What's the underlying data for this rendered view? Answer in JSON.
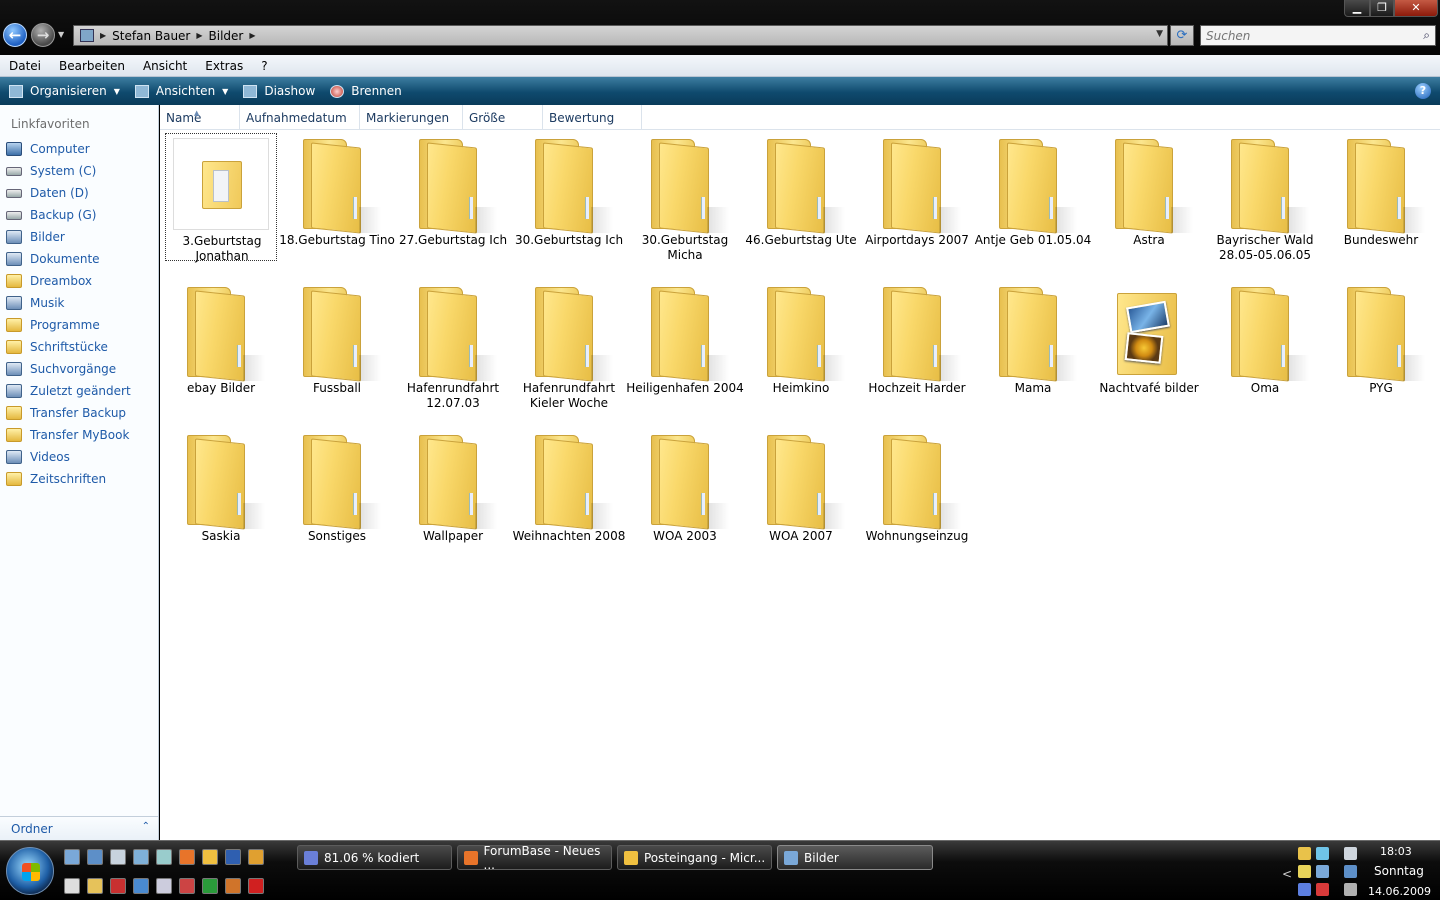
{
  "window": {
    "controls": {
      "minimize": "▁",
      "maximize": "❐",
      "close": "✕"
    }
  },
  "address": {
    "crumbs": [
      "Stefan Bauer",
      "Bilder"
    ],
    "search_placeholder": "Suchen"
  },
  "menu": [
    "Datei",
    "Bearbeiten",
    "Ansicht",
    "Extras",
    "?"
  ],
  "toolbar": {
    "organize": "Organisieren",
    "views": "Ansichten",
    "slideshow": "Diashow",
    "burn": "Brennen",
    "help": "?"
  },
  "nav": {
    "heading": "Linkfavoriten",
    "items": [
      {
        "label": "Computer",
        "icon": "computer-icon"
      },
      {
        "label": "System (C)",
        "icon": "drive-icon"
      },
      {
        "label": "Daten (D)",
        "icon": "drive-icon"
      },
      {
        "label": "Backup (G)",
        "icon": "drive-icon"
      },
      {
        "label": "Bilder",
        "icon": "pictures-icon"
      },
      {
        "label": "Dokumente",
        "icon": "documents-icon"
      },
      {
        "label": "Dreambox",
        "icon": "folder-icon"
      },
      {
        "label": "Musik",
        "icon": "music-icon"
      },
      {
        "label": "Programme",
        "icon": "folder-icon"
      },
      {
        "label": "Schriftstücke",
        "icon": "folder-icon"
      },
      {
        "label": "Suchvorgänge",
        "icon": "search-folder-icon"
      },
      {
        "label": "Zuletzt geändert",
        "icon": "recent-icon"
      },
      {
        "label": "Transfer Backup",
        "icon": "folder-icon"
      },
      {
        "label": "Transfer MyBook",
        "icon": "folder-icon"
      },
      {
        "label": "Videos",
        "icon": "videos-icon"
      },
      {
        "label": "Zeitschriften",
        "icon": "folder-icon"
      }
    ],
    "folders_toggle": "Ordner",
    "folders_chevron": "⌃"
  },
  "columns": [
    "Name",
    "Aufnahmedatum",
    "Markierungen",
    "Größe",
    "Bewertung"
  ],
  "items": [
    {
      "label": "3.Geburtstag Jonathan",
      "kind": "thumbnail-folder",
      "selected": true
    },
    {
      "label": "18.Geburtstag Tino",
      "kind": "folder"
    },
    {
      "label": "27.Geburtstag Ich",
      "kind": "folder"
    },
    {
      "label": "30.Geburtstag Ich",
      "kind": "folder"
    },
    {
      "label": "30.Geburtstag Micha",
      "kind": "folder"
    },
    {
      "label": "46.Geburtstag Ute",
      "kind": "folder"
    },
    {
      "label": "Airportdays 2007",
      "kind": "folder"
    },
    {
      "label": "Antje Geb 01.05.04",
      "kind": "folder"
    },
    {
      "label": "Astra",
      "kind": "folder"
    },
    {
      "label": "Bayrischer Wald 28.05-05.06.05",
      "kind": "folder"
    },
    {
      "label": "Bundeswehr",
      "kind": "folder"
    },
    {
      "label": "ebay Bilder",
      "kind": "folder"
    },
    {
      "label": "Fussball",
      "kind": "folder"
    },
    {
      "label": "Hafenrundfahrt 12.07.03",
      "kind": "folder"
    },
    {
      "label": "Hafenrundfahrt Kieler Woche",
      "kind": "folder"
    },
    {
      "label": "Heiligenhafen 2004",
      "kind": "folder"
    },
    {
      "label": "Heimkino",
      "kind": "folder"
    },
    {
      "label": "Hochzeit Harder",
      "kind": "folder"
    },
    {
      "label": "Mama",
      "kind": "folder"
    },
    {
      "label": "Nachtvafé bilder",
      "kind": "photo-folder"
    },
    {
      "label": "Oma",
      "kind": "folder"
    },
    {
      "label": "PYG",
      "kind": "folder"
    },
    {
      "label": "Saskia",
      "kind": "folder"
    },
    {
      "label": "Sonstiges",
      "kind": "folder"
    },
    {
      "label": "Wallpaper",
      "kind": "folder"
    },
    {
      "label": "Weihnachten 2008",
      "kind": "folder"
    },
    {
      "label": "WOA 2003",
      "kind": "folder"
    },
    {
      "label": "WOA 2007",
      "kind": "folder"
    },
    {
      "label": "Wohnungseinzug",
      "kind": "folder"
    }
  ],
  "taskbar": {
    "quicklaunch_row1": [
      "show-desktop-icon",
      "switch-windows-icon",
      "network-icon",
      "explorer-icon",
      "notepad-icon",
      "firefox-icon",
      "outlook-icon",
      "word-icon",
      "media-icon"
    ],
    "quicklaunch_row2": [
      "tv-icon",
      "folder-icon",
      "opera-icon",
      "ie-icon",
      "calc-icon",
      "tools-icon",
      "project-icon",
      "games-icon",
      "poker-icon"
    ],
    "tasks": [
      {
        "label": "81.06 % kodiert",
        "icon": "encoder-icon",
        "active": false
      },
      {
        "label": "ForumBase - Neues ...",
        "icon": "firefox-icon",
        "active": false
      },
      {
        "label": "Posteingang - Micr...",
        "icon": "outlook-icon",
        "active": false
      },
      {
        "label": "Bilder",
        "icon": "explorer-icon",
        "active": true
      }
    ],
    "tray_expand": "<",
    "clock": {
      "time": "18:03",
      "day": "Sonntag",
      "date": "14.06.2009"
    }
  }
}
